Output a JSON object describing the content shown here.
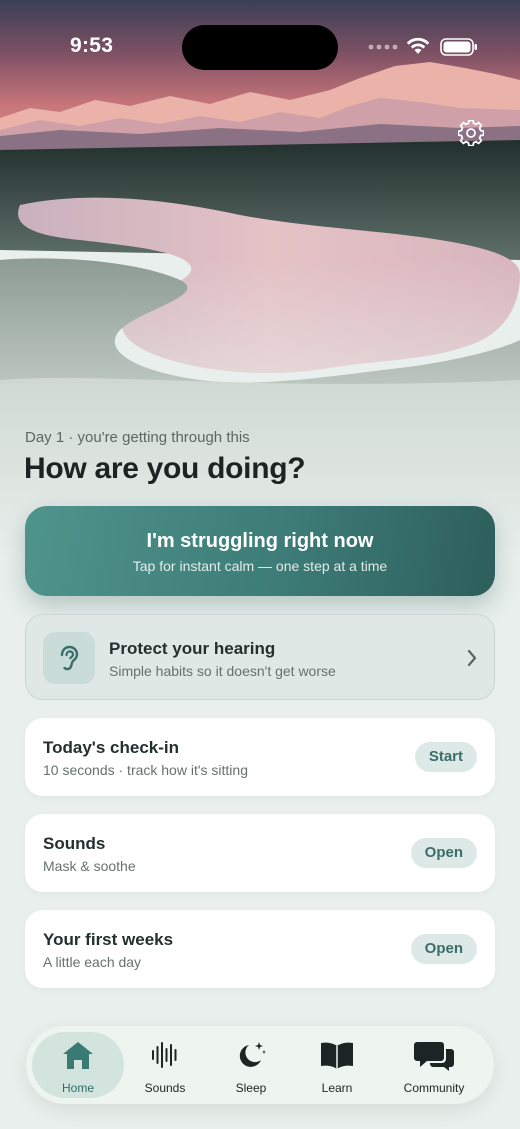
{
  "status_bar": {
    "time": "9:53",
    "signal_icon": "cellular-dots-icon",
    "wifi_icon": "wifi-icon",
    "battery_icon": "battery-icon"
  },
  "header": {
    "settings_icon": "gear-icon"
  },
  "greeting": {
    "day_label": "Day 1 · you're getting through this",
    "title": "How are you doing?"
  },
  "struggle": {
    "title": "I'm struggling right now",
    "subtitle": "Tap for instant calm — one step at a time",
    "color": "#3d7c77"
  },
  "hearing": {
    "icon": "ear-icon",
    "title": "Protect your hearing",
    "subtitle": "Simple habits so it doesn't get worse"
  },
  "cards": [
    {
      "title": "Today's check-in",
      "subtitle": "10 seconds · track how it's sitting",
      "action": "Start"
    },
    {
      "title": "Sounds",
      "subtitle": "Mask & soothe",
      "action": "Open"
    },
    {
      "title": "Your first weeks",
      "subtitle": "A little each day",
      "action": "Open"
    }
  ],
  "tabs": [
    {
      "label": "Home",
      "icon": "home-icon",
      "active": true
    },
    {
      "label": "Sounds",
      "icon": "sound-wave-icon",
      "active": false
    },
    {
      "label": "Sleep",
      "icon": "moon-stars-icon",
      "active": false
    },
    {
      "label": "Learn",
      "icon": "book-icon",
      "active": false
    },
    {
      "label": "Community",
      "icon": "chat-bubbles-icon",
      "active": false
    }
  ],
  "accent_color": "#3a6e6a"
}
